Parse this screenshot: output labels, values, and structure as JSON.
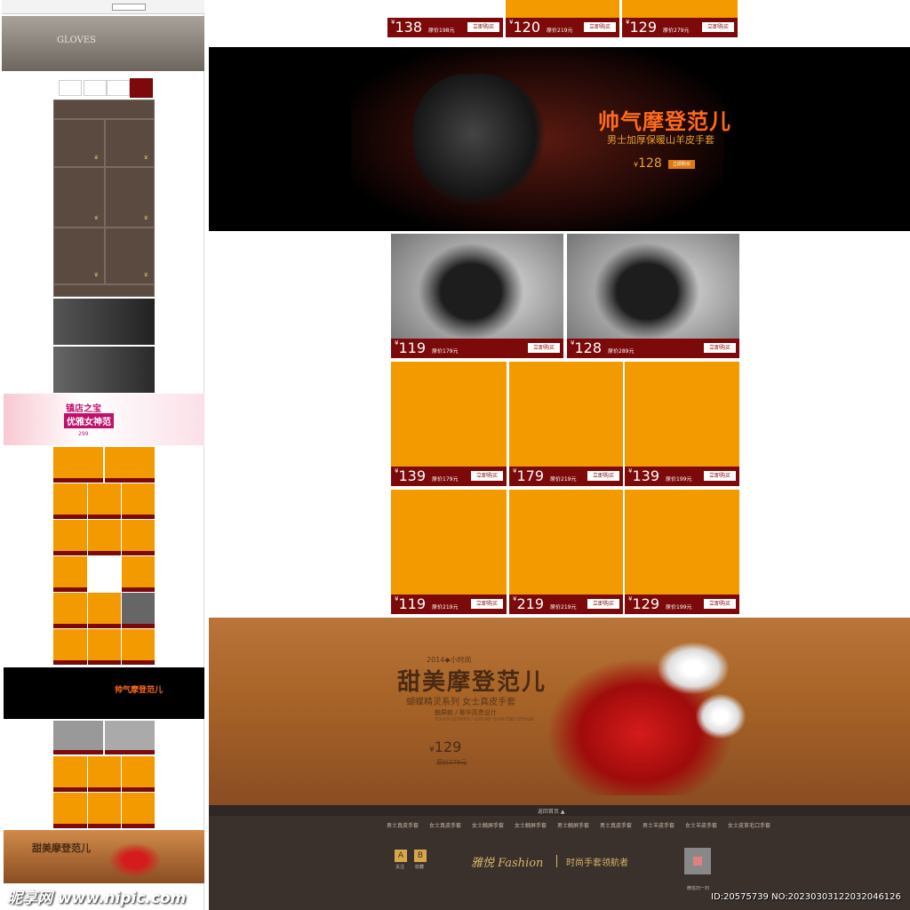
{
  "left": {
    "gloves_title": "GLOVES",
    "pink_title_1": "镇店之宝",
    "pink_title_2": "优雅女神范",
    "pink_price": "299",
    "black_title": "帅气摩登范儿",
    "brown_title": "甜美摩登范儿",
    "watermark": "昵享网 www.nipic.com"
  },
  "top_row": [
    {
      "price": "138",
      "orig": "原价198元",
      "buy": "立即购买"
    },
    {
      "price": "120",
      "orig": "原价219元",
      "buy": "立即购买"
    },
    {
      "price": "129",
      "orig": "原价279元",
      "buy": "立即购买"
    }
  ],
  "hero": {
    "title": "帅气摩登范儿",
    "subtitle": "男士加厚保暖山羊皮手套",
    "price": "128",
    "buy": "立即购买"
  },
  "photo_row": [
    {
      "price": "119",
      "orig": "原价179元",
      "buy": "立即购买"
    },
    {
      "price": "128",
      "orig": "原价289元",
      "buy": "立即购买"
    }
  ],
  "grid_row1": [
    {
      "price": "139",
      "orig": "原价179元",
      "buy": "立即购买"
    },
    {
      "price": "179",
      "orig": "原价219元",
      "buy": "立即购买"
    },
    {
      "price": "139",
      "orig": "原价199元",
      "buy": "立即购买"
    }
  ],
  "grid_row2": [
    {
      "price": "119",
      "orig": "原价219元",
      "buy": "立即购买"
    },
    {
      "price": "219",
      "orig": "原价219元",
      "buy": "立即购买"
    },
    {
      "price": "129",
      "orig": "原价199元",
      "buy": "立即购买"
    }
  ],
  "promo": {
    "year": "2014◆小时尚",
    "title": "甜美摩登范儿",
    "series": "蝴蝶精灵系列  女士真皮手套",
    "line1": "触屏款 / 奢华高贵设计",
    "line2": "TOUCH SCREEN / LUXURY HIGH-END DESIGN",
    "price": "129",
    "orig": "原价279元"
  },
  "footer": {
    "back_top": "返回首页 ▲",
    "nav": [
      "男士真皮手套",
      "女士真皮手套",
      "女士触屏手套",
      "女士触屏手套",
      "男士触屏手套",
      "男士真皮手套",
      "男士羊皮手套",
      "女士羊皮手套",
      "女士皮草毛口手套"
    ],
    "fav": "关注",
    "col": "收藏",
    "brand": "雅悦 Fashion",
    "slogan": "时尚手套领航者",
    "qr_label": "微信扫一扫"
  },
  "id_text": "ID:20575739 NO:20230303122032046126"
}
